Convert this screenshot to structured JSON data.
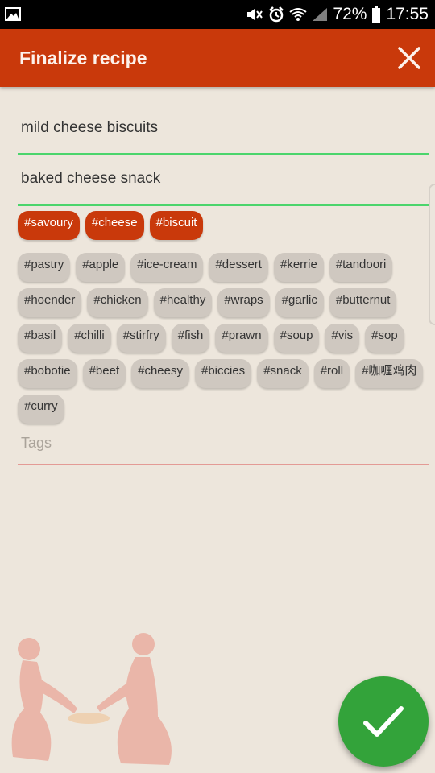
{
  "status_bar": {
    "battery": "72%",
    "time": "17:55"
  },
  "app_bar": {
    "title": "Finalize recipe"
  },
  "fields": {
    "name": "mild cheese biscuits",
    "subtitle": "baked cheese snack"
  },
  "selected_tags": [
    "#savoury",
    "#cheese",
    "#biscuit"
  ],
  "tags": [
    "#pastry",
    "#apple",
    "#ice-cream",
    "#dessert",
    "#kerrie",
    "#tandoori",
    "#hoender",
    "#chicken",
    "#healthy",
    "#wraps",
    "#garlic",
    "#butternut",
    "#basil",
    "#chilli",
    "#stirfry",
    "#fish",
    "#prawn",
    "#soup",
    "#vis",
    "#sop",
    "#bobotie",
    "#beef",
    "#cheesy",
    "#biccies",
    "#snack",
    "#roll",
    "#咖喱鸡肉",
    "#curry"
  ],
  "tags_input": {
    "placeholder": "Tags"
  },
  "colors": {
    "accent": "#c9390b",
    "fab": "#33a33a",
    "underline": "#4bd56c"
  }
}
